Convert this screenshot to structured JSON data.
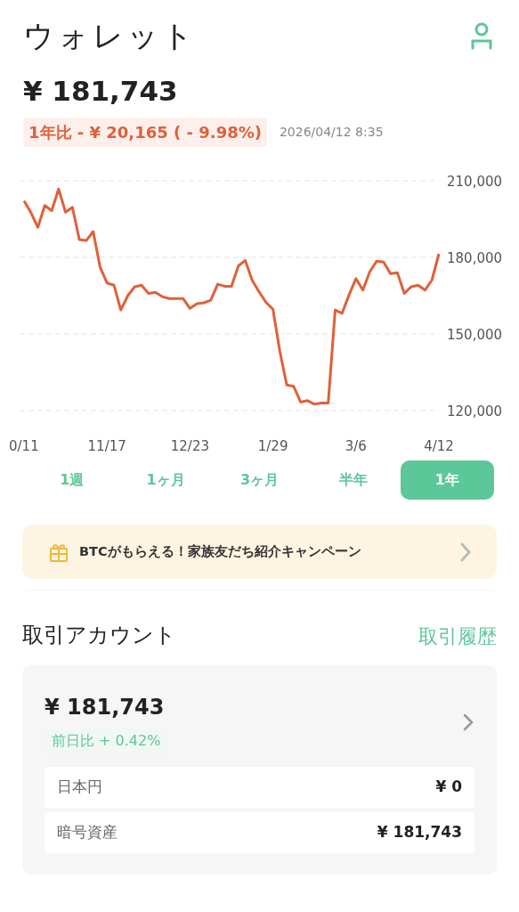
{
  "header": {
    "title": "ウォレット"
  },
  "balance": {
    "amount": "¥ 181,743",
    "change": "1年比 - ¥ 20,165 ( - 9.98%)",
    "timestamp": "2026/04/12 8:35"
  },
  "chart": {
    "chart_data": {
      "type": "line",
      "categories": [
        "0/11",
        null,
        null,
        null,
        null,
        null,
        null,
        null,
        null,
        null,
        null,
        null,
        "11/17",
        null,
        null,
        null,
        null,
        null,
        null,
        null,
        null,
        null,
        null,
        null,
        "12/23",
        null,
        null,
        null,
        null,
        null,
        null,
        null,
        null,
        null,
        null,
        null,
        "1/29",
        null,
        null,
        null,
        null,
        null,
        null,
        null,
        null,
        null,
        null,
        null,
        "3/6",
        null,
        null,
        null,
        null,
        null,
        null,
        null,
        null,
        null,
        null,
        null,
        "4/12"
      ],
      "series": [
        {
          "color": "#e0603a",
          "values": [
            202200,
            197500,
            191800,
            200300,
            198300,
            206800,
            197700,
            199600,
            187000,
            186600,
            190100,
            176200,
            170000,
            169100,
            159400,
            165000,
            168500,
            169100,
            165900,
            166300,
            164600,
            163900,
            163900,
            163900,
            160000,
            161900,
            162200,
            163200,
            169500,
            168700,
            168700,
            176700,
            178800,
            171000,
            166500,
            162400,
            159700,
            143100,
            130000,
            129500,
            123300,
            123900,
            122500,
            123000,
            123000,
            159400,
            158100,
            165200,
            171700,
            167200,
            174300,
            178500,
            178200,
            173600,
            174000,
            165900,
            168500,
            169100,
            167200,
            171100,
            181400
          ]
        }
      ],
      "ylim": [
        120000,
        210000
      ],
      "yticks": [
        {
          "value": 210000,
          "label": "210,000"
        },
        {
          "value": 180000,
          "label": "180,000"
        },
        {
          "value": 150000,
          "label": "150,000"
        },
        {
          "value": 120000,
          "label": "120,000"
        }
      ]
    }
  },
  "range_tabs": [
    {
      "label": "1週",
      "selected": false
    },
    {
      "label": "1ヶ月",
      "selected": false
    },
    {
      "label": "3ヶ月",
      "selected": false
    },
    {
      "label": "半年",
      "selected": false
    },
    {
      "label": "1年",
      "selected": true
    }
  ],
  "banner": {
    "text": "BTCがもらえる！家族友だち紹介キャンペーン"
  },
  "account_section": {
    "title": "取引アカウント",
    "link": "取引履歴"
  },
  "account_card": {
    "amount": "¥ 181,743",
    "day_change": "前日比 + 0.42%",
    "rows": [
      {
        "label": "日本円",
        "value": "¥ 0"
      },
      {
        "label": "暗号資産",
        "value": "¥ 181,743"
      }
    ]
  }
}
